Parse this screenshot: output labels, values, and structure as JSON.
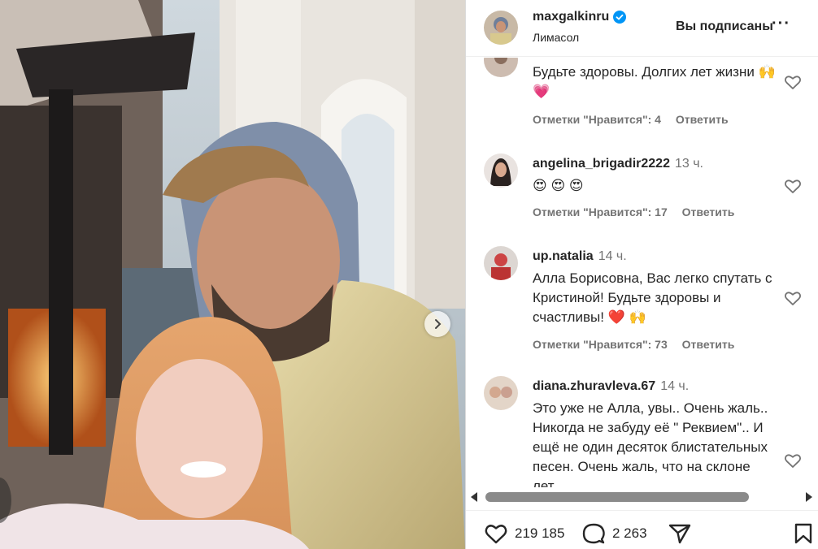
{
  "header": {
    "username": "maxgalkinru",
    "location": "Лимасол",
    "follow_status": "Вы подписаны",
    "more_label": "···"
  },
  "comments": [
    {
      "username": "",
      "time": "",
      "text": "Будьте здоровы. Долгих лет жизни 🙌 💗",
      "likes": "Отметки \"Нравится\": 4",
      "reply": "Ответить"
    },
    {
      "username": "angelina_brigadir2222",
      "time": "13 ч.",
      "text": "😍 😍 😍",
      "likes": "Отметки \"Нравится\": 17",
      "reply": "Ответить"
    },
    {
      "username": "up.natalia",
      "time": "14 ч.",
      "text": "Алла Борисовна, Вас легко спутать с Кристиной! Будьте здоровы и счастливы! ❤️ 🙌",
      "likes": "Отметки \"Нравится\": 73",
      "reply": "Ответить"
    },
    {
      "username": "diana.zhuravleva.67",
      "time": "14 ч.",
      "text": "Это уже не Алла, увы.. Очень жаль.. Никогда не забуду её \" Реквием\".. И ещё не один десяток блистательных песен. Очень жаль, что на склоне лет...",
      "likes": "",
      "reply": ""
    }
  ],
  "actions": {
    "likes_count": "219 185",
    "comments_count": "2 263"
  },
  "colors": {
    "text": "#262626",
    "muted": "#737373",
    "verified": "#0095f6",
    "heart_emoji": "#e0245e"
  },
  "icons": {
    "like": "heart-icon",
    "comment": "comment-bubble-icon",
    "share": "paper-plane-icon",
    "save": "bookmark-icon",
    "next": "chevron-right-icon"
  }
}
